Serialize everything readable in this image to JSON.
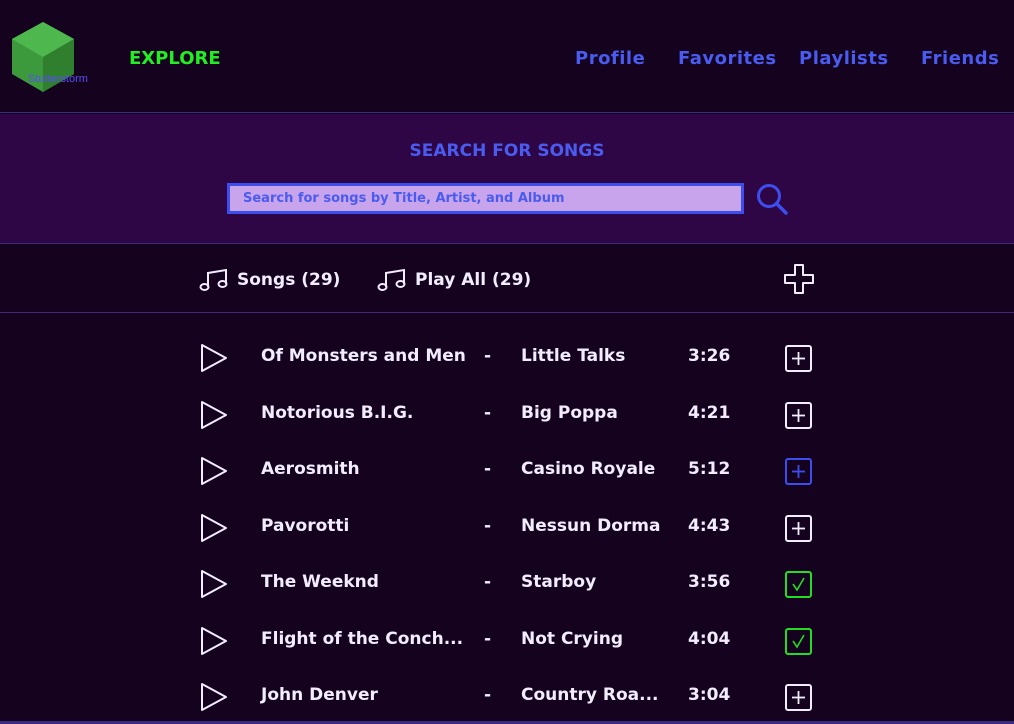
{
  "brand": {
    "name": "Stutterstorm"
  },
  "nav": {
    "explore": "EXPLORE",
    "profile": "Profile",
    "favorites": "Favorites",
    "playlists": "Playlists",
    "friends": "Friends"
  },
  "search": {
    "title": "SEARCH FOR SONGS",
    "placeholder": "Search for songs by Title, Artist, and Album",
    "value": ""
  },
  "toolbar": {
    "songs_label": "Songs (29)",
    "play_all_label": "Play All (29)"
  },
  "colors": {
    "background": "#14021f",
    "search_panel": "#2e0646",
    "accent_blue": "#4a5cf0",
    "explore_green": "#22ee22",
    "added_green": "#22dd22",
    "text": "#f2ecff"
  },
  "songs": [
    {
      "artist": "Of Monsters and Men",
      "dash": "-",
      "title": "Little Talks",
      "duration": "3:26",
      "state": "add"
    },
    {
      "artist": "Notorious B.I.G.",
      "dash": "-",
      "title": "Big Poppa",
      "duration": "4:21",
      "state": "add"
    },
    {
      "artist": "Aerosmith",
      "dash": "-",
      "title": "Casino Royale",
      "duration": "5:12",
      "state": "add-highlight"
    },
    {
      "artist": "Pavorotti",
      "dash": "-",
      "title": "Nessun Dorma",
      "duration": "4:43",
      "state": "add"
    },
    {
      "artist": "The Weeknd",
      "dash": "-",
      "title": "Starboy",
      "duration": "3:56",
      "state": "added"
    },
    {
      "artist": "Flight of the Conch...",
      "dash": "-",
      "title": "Not Crying",
      "duration": "4:04",
      "state": "added"
    },
    {
      "artist": "John Denver",
      "dash": "-",
      "title": "Country Roa...",
      "duration": "3:04",
      "state": "add"
    }
  ]
}
